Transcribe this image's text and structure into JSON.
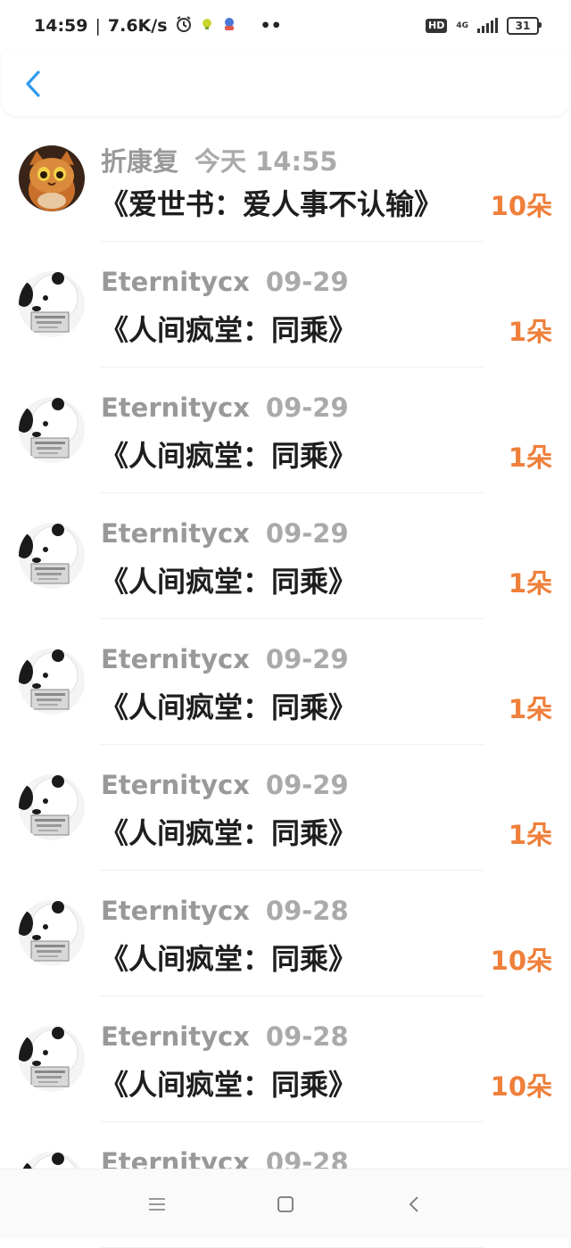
{
  "status_bar": {
    "time": "14:59",
    "speed": "7.6K/s",
    "hd_label": "HD",
    "network": "4G",
    "battery": "31",
    "icons": [
      "alarm-icon",
      "notification-icon",
      "app-icon",
      "more-icon",
      "hd-icon",
      "signal-icon",
      "battery-icon"
    ]
  },
  "header": {
    "back_icon": "chevron-left-icon",
    "accent": "#2f9bf0"
  },
  "colors": {
    "amount": "#ef7f3a",
    "title": "#1e1e1e",
    "meta": "#999999"
  },
  "items": [
    {
      "name": "折康复",
      "time": "今天 14:55",
      "title": "《爱世书：爱人事不认输》",
      "amount": "10朵",
      "avatar": "cat-avatar"
    },
    {
      "name": "Eternitycx",
      "time": "09-29",
      "title": "《人间疯堂：同乘》",
      "amount": "1朵",
      "avatar": "bear-avatar"
    },
    {
      "name": "Eternitycx",
      "time": "09-29",
      "title": "《人间疯堂：同乘》",
      "amount": "1朵",
      "avatar": "bear-avatar"
    },
    {
      "name": "Eternitycx",
      "time": "09-29",
      "title": "《人间疯堂：同乘》",
      "amount": "1朵",
      "avatar": "bear-avatar"
    },
    {
      "name": "Eternitycx",
      "time": "09-29",
      "title": "《人间疯堂：同乘》",
      "amount": "1朵",
      "avatar": "bear-avatar"
    },
    {
      "name": "Eternitycx",
      "time": "09-29",
      "title": "《人间疯堂：同乘》",
      "amount": "1朵",
      "avatar": "bear-avatar"
    },
    {
      "name": "Eternitycx",
      "time": "09-28",
      "title": "《人间疯堂：同乘》",
      "amount": "10朵",
      "avatar": "bear-avatar"
    },
    {
      "name": "Eternitycx",
      "time": "09-28",
      "title": "《人间疯堂：同乘》",
      "amount": "10朵",
      "avatar": "bear-avatar"
    },
    {
      "name": "Eternitycx",
      "time": "09-28",
      "title": "",
      "amount": "",
      "avatar": "bear-avatar"
    }
  ],
  "nav_bar": {
    "icons": [
      "menu-icon",
      "home-icon",
      "back-icon"
    ]
  }
}
